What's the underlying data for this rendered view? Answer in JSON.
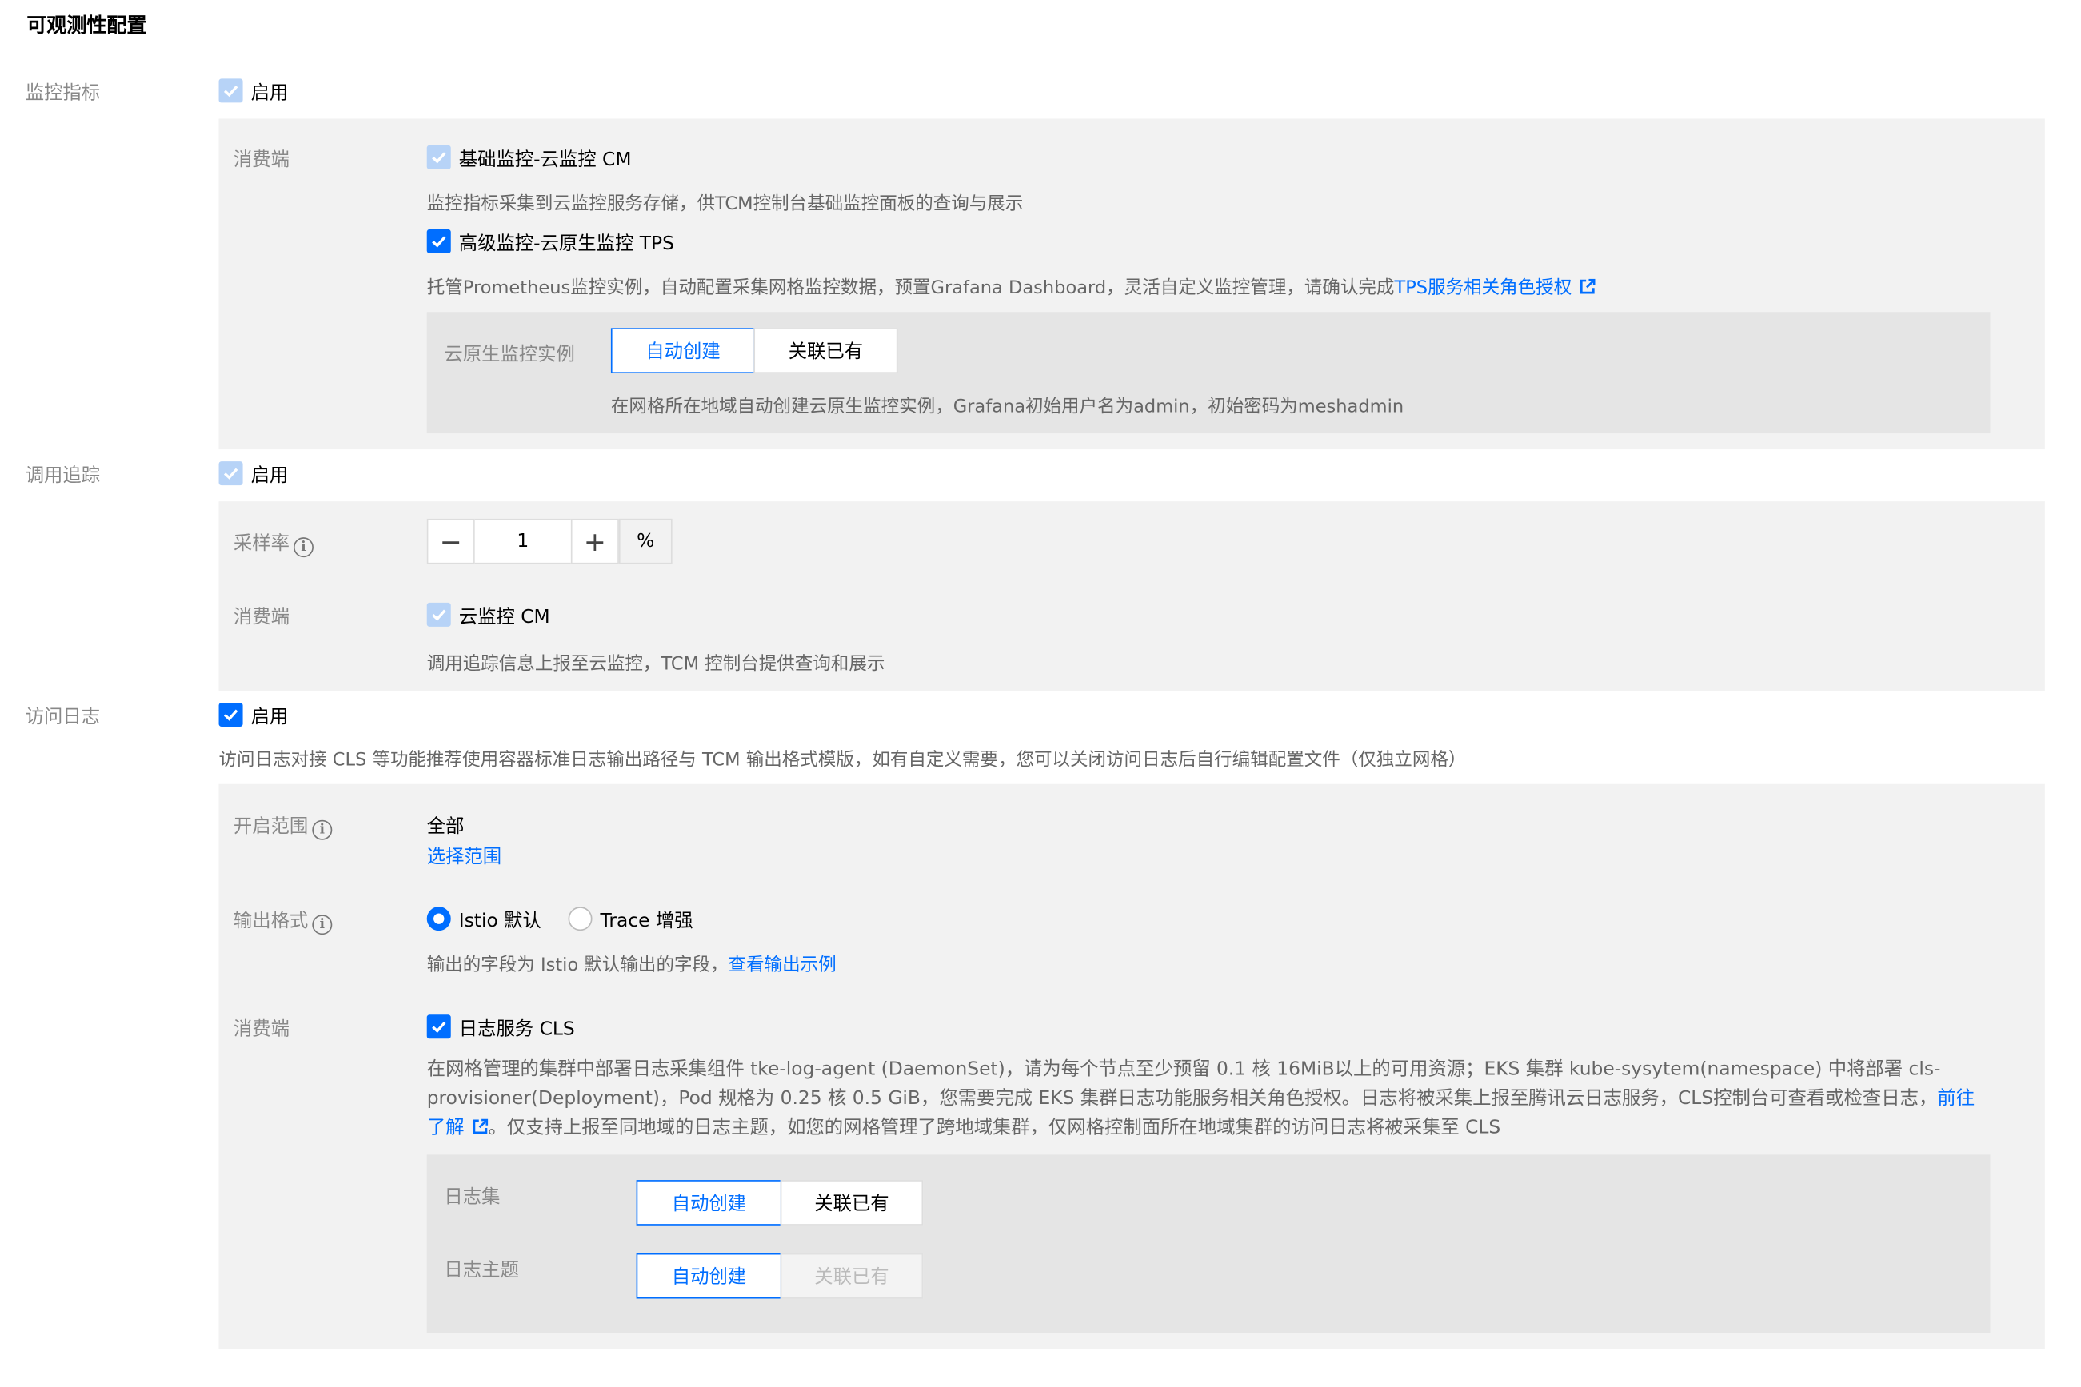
{
  "page": {
    "title": "可观测性配置"
  },
  "metrics": {
    "label": "监控指标",
    "enable_label": "启用",
    "consumer_label": "消费端",
    "cm_label": "基础监控-云监控 CM",
    "cm_desc": "监控指标采集到云监控服务存储，供TCM控制台基础监控面板的查询与展示",
    "tps_label": "高级监控-云原生监控 TPS",
    "tps_desc": "托管Prometheus监控实例，自动配置采集网格监控数据，预置Grafana Dashboard，灵活自定义监控管理，请确认完成",
    "tps_link": "TPS服务相关角色授权",
    "instance_label": "云原生监控实例",
    "auto_create": "自动创建",
    "associate": "关联已有",
    "instance_desc": "在网格所在地域自动创建云原生监控实例，Grafana初始用户名为admin，初始密码为meshadmin"
  },
  "tracing": {
    "label": "调用追踪",
    "enable_label": "启用",
    "sampling_label": "采样率",
    "sampling_value": "1",
    "minus": "−",
    "plus": "+",
    "unit": "%",
    "consumer_label": "消费端",
    "cm_label": "云监控 CM",
    "cm_desc": "调用追踪信息上报至云监控，TCM 控制台提供查询和展示"
  },
  "access_log": {
    "label": "访问日志",
    "enable_label": "启用",
    "desc": "访问日志对接 CLS 等功能推荐使用容器标准日志输出路径与 TCM 输出格式模版，如有自定义需要，您可以关闭访问日志后自行编辑配置文件（仅独立网格）",
    "scope_label": "开启范围",
    "scope_value": "全部",
    "scope_link": "选择范围",
    "format_label": "输出格式",
    "format_istio": "Istio 默认",
    "format_trace": "Trace 增强",
    "format_desc": "输出的字段为 Istio 默认输出的字段，",
    "format_link": "查看输出示例",
    "consumer_label": "消费端",
    "cls_label": "日志服务 CLS",
    "cls_desc_1": "在网格管理的集群中部署日志采集组件 tke-log-agent (DaemonSet)，请为每个节点至少预留 0.1 核 16MiB以上的可用资源；EKS 集群 kube-sysytem(namespace) 中将部署 cls-provisioner(Deployment)，Pod 规格为 0.25 核 0.5 GiB，您需要完成 EKS 集群日志功能服务相关角色授权。日志将被采集上报至腾讯云日志服务，CLS控制台可查看或检查日志，",
    "cls_link": "前往了解",
    "cls_desc_2": "。仅支持上报至同地域的日志主题，如您的网格管理了跨地域集群，仅网格控制面所在地域集群的访问日志将被采集至 CLS",
    "logset_label": "日志集",
    "topic_label": "日志主题",
    "auto_create": "自动创建",
    "associate": "关联已有"
  },
  "colors": {
    "accent": "#006eff",
    "panel": "#f2f2f2",
    "subpanel": "#e5e5e5"
  }
}
